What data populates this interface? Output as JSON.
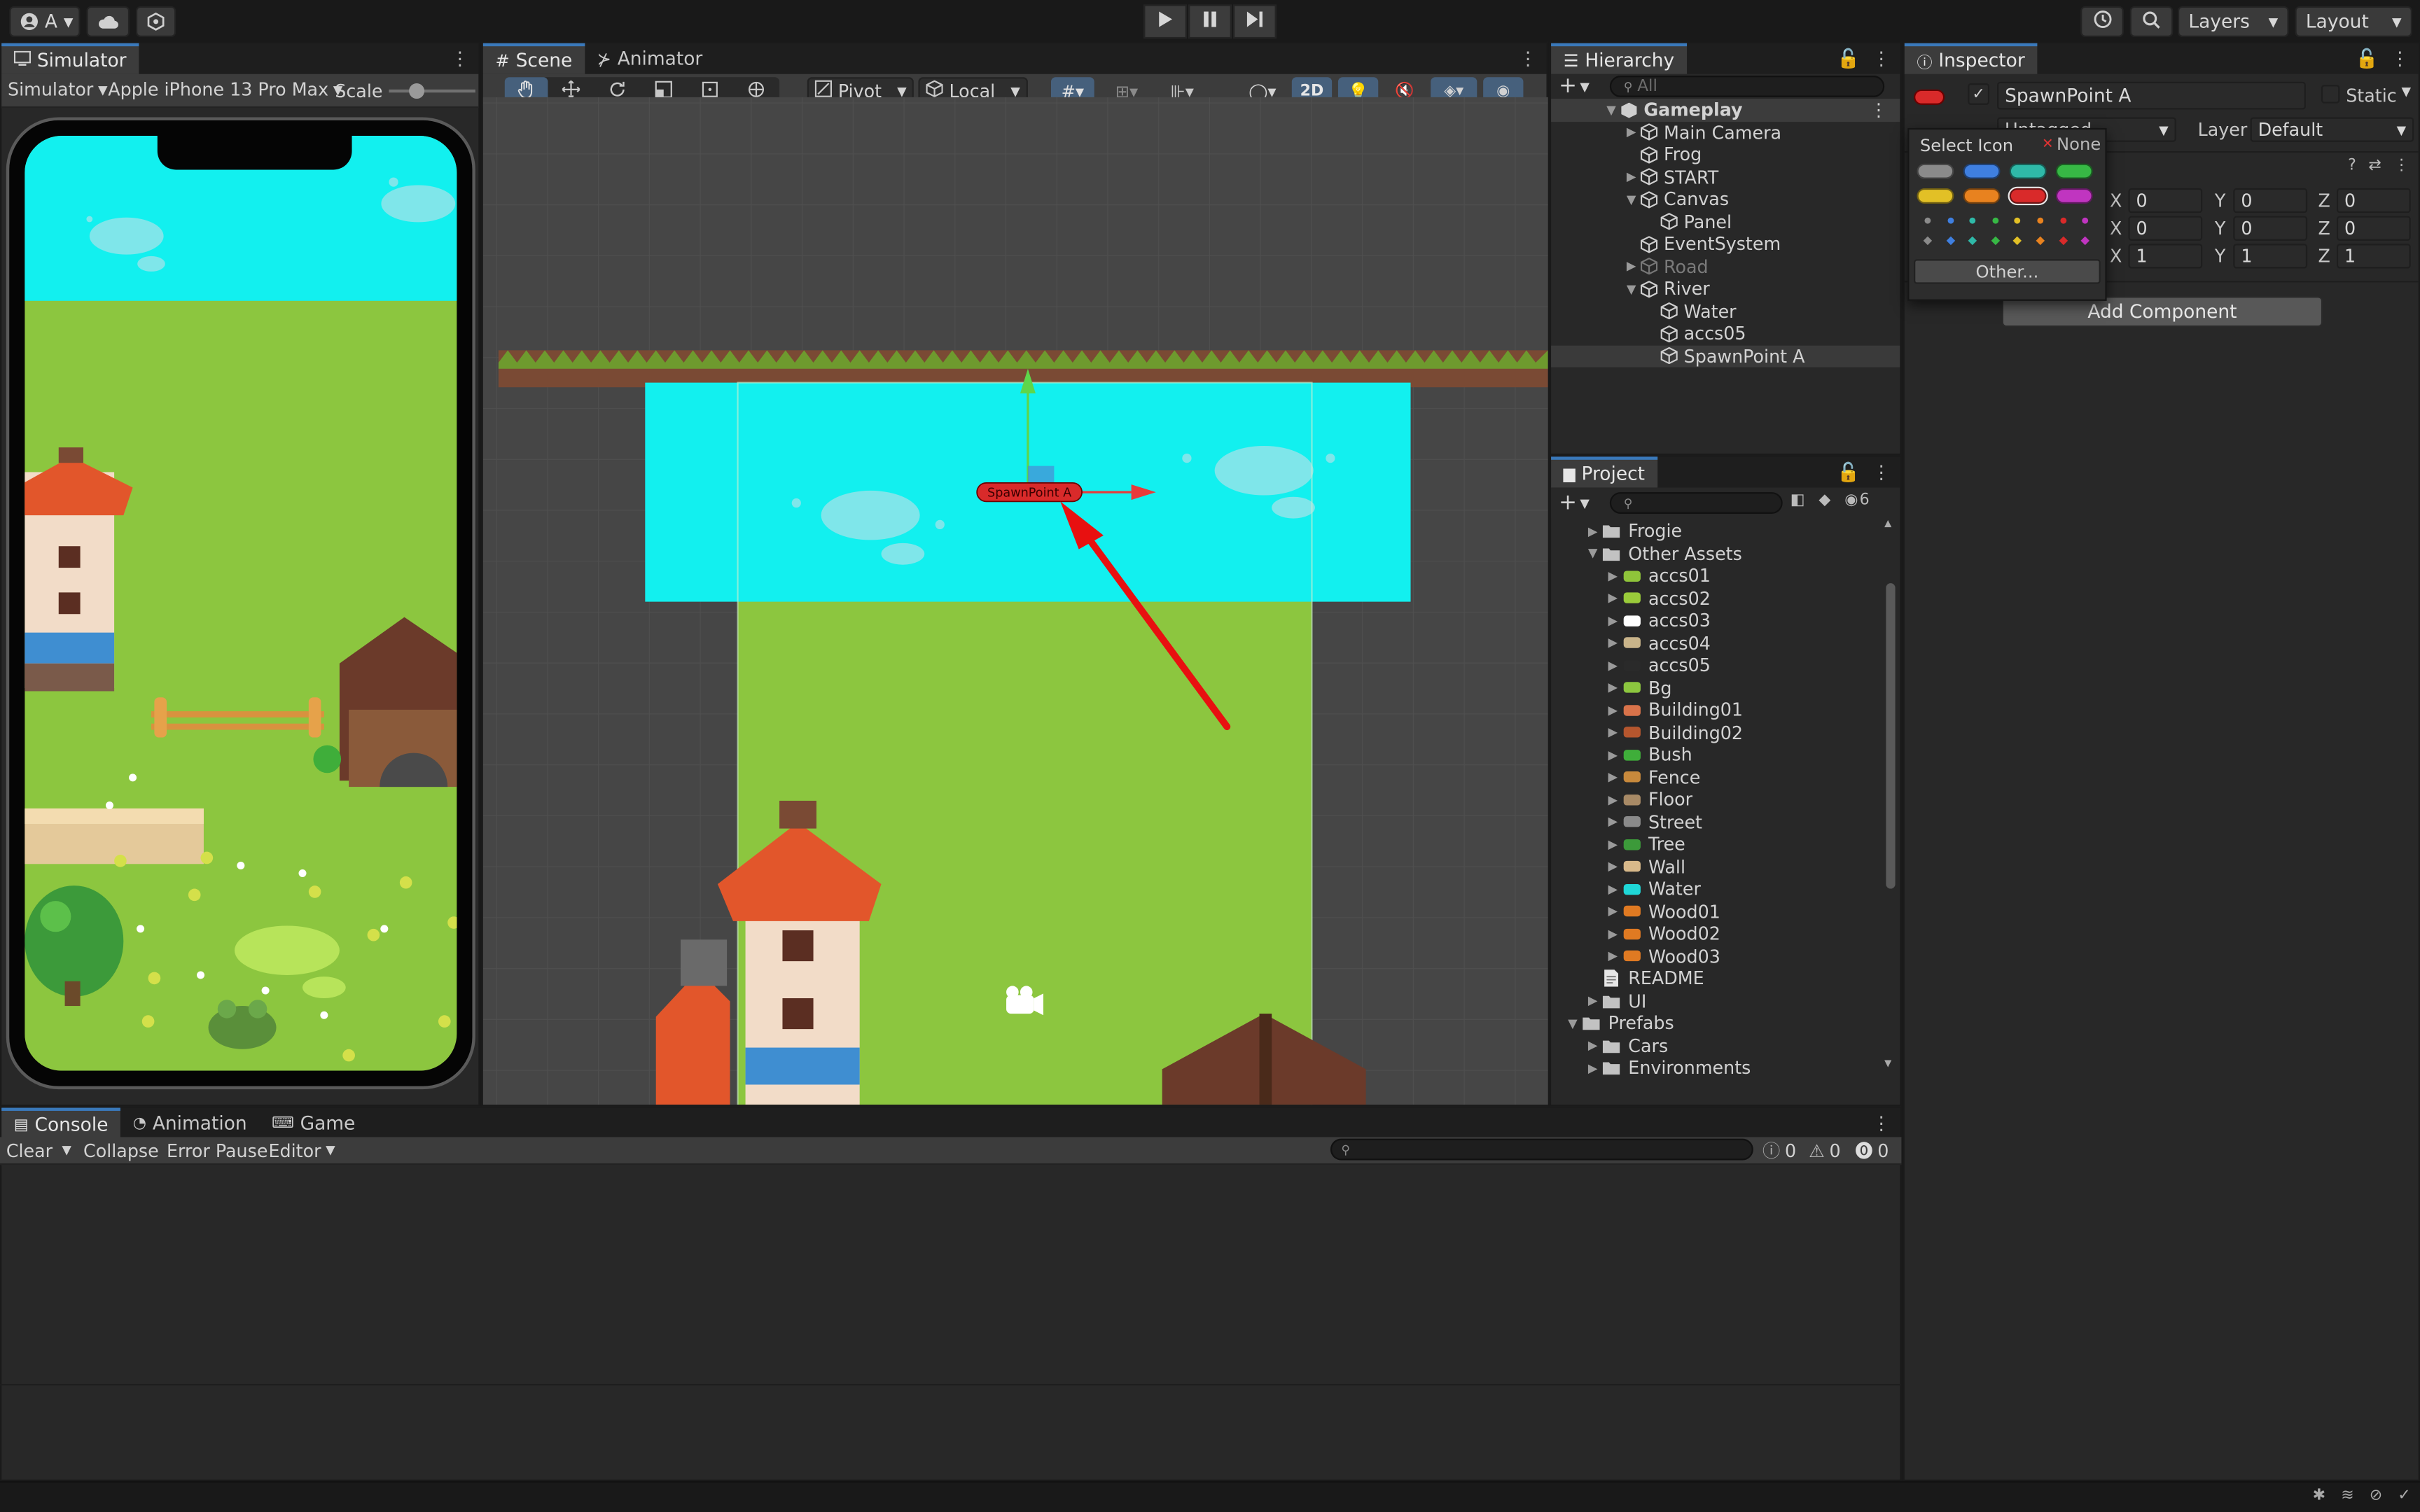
{
  "toolbar": {
    "account_label": "A",
    "layers_label": "Layers",
    "layout_label": "Layout"
  },
  "simulator": {
    "tab_label": "Simulator",
    "mode_label": "Simulator",
    "device_label": "Apple iPhone 13 Pro Max",
    "scale_label": "Scale"
  },
  "scene": {
    "tab_label": "Scene",
    "animator_tab_label": "Animator",
    "pivot_label": "Pivot",
    "local_label": "Local",
    "mode_2d_label": "2D",
    "gizmo_label": "SpawnPoint A"
  },
  "hierarchy": {
    "tab_label": "Hierarchy",
    "search_placeholder": "All",
    "items": [
      {
        "label": "Gameplay",
        "kind": "scene"
      },
      {
        "label": "Main Camera",
        "kind": "object"
      },
      {
        "label": "Frog",
        "kind": "object"
      },
      {
        "label": "START",
        "kind": "object"
      },
      {
        "label": "Canvas",
        "kind": "object"
      },
      {
        "label": "Panel",
        "kind": "object"
      },
      {
        "label": "EventSystem",
        "kind": "object"
      },
      {
        "label": "Road",
        "kind": "disabled"
      },
      {
        "label": "River",
        "kind": "object"
      },
      {
        "label": "Water",
        "kind": "object"
      },
      {
        "label": "accs05",
        "kind": "object"
      },
      {
        "label": "SpawnPoint A",
        "kind": "selected"
      }
    ]
  },
  "project": {
    "tab_label": "Project",
    "hidden_count": "6",
    "items": [
      {
        "label": "Frogie",
        "icon": "folder-icon"
      },
      {
        "label": "Other Assets",
        "icon": "folder-open-icon"
      },
      {
        "label": "accs01",
        "icon": "sprite-icon",
        "color": "#8fc43a"
      },
      {
        "label": "accs02",
        "icon": "sprite-icon",
        "color": "#9acb3a"
      },
      {
        "label": "accs03",
        "icon": "sprite-icon",
        "color": "#ffffff"
      },
      {
        "label": "accs04",
        "icon": "sprite-icon",
        "color": "#c9b48a"
      },
      {
        "label": "accs05",
        "icon": "sprite-icon",
        "color": "#2a2a2a"
      },
      {
        "label": "Bg",
        "icon": "sprite-icon",
        "color": "#8cc63f"
      },
      {
        "label": "Building01",
        "icon": "sprite-icon",
        "color": "#d9734a"
      },
      {
        "label": "Building02",
        "icon": "sprite-icon",
        "color": "#b5562e"
      },
      {
        "label": "Bush",
        "icon": "sprite-icon",
        "color": "#3fae3a"
      },
      {
        "label": "Fence",
        "icon": "sprite-icon",
        "color": "#c8893c"
      },
      {
        "label": "Floor",
        "icon": "sprite-icon",
        "color": "#a88a66"
      },
      {
        "label": "Street",
        "icon": "sprite-icon",
        "color": "#8a8a8a"
      },
      {
        "label": "Tree",
        "icon": "sprite-icon",
        "color": "#3c9a3a"
      },
      {
        "label": "Wall",
        "icon": "sprite-icon",
        "color": "#d8b98a"
      },
      {
        "label": "Water",
        "icon": "sprite-icon",
        "color": "#1fd7d7"
      },
      {
        "label": "Wood01",
        "icon": "sprite-icon",
        "color": "#e07a22"
      },
      {
        "label": "Wood02",
        "icon": "sprite-icon",
        "color": "#e07a22"
      },
      {
        "label": "Wood03",
        "icon": "sprite-icon",
        "color": "#e07a22"
      },
      {
        "label": "README",
        "icon": "document-icon"
      },
      {
        "label": "UI",
        "icon": "folder-icon"
      },
      {
        "label": "Prefabs",
        "icon": "folder-open-icon"
      },
      {
        "label": "Cars",
        "icon": "folder-icon"
      },
      {
        "label": "Environments",
        "icon": "folder-icon"
      }
    ]
  },
  "inspector": {
    "tab_label": "Inspector",
    "object_name": "SpawnPoint A",
    "static_label": "Static",
    "tag_value": "Untagged",
    "layer_label": "Layer",
    "layer_value": "Default",
    "position": {
      "x": "0",
      "y": "0",
      "z": "0"
    },
    "rotation": {
      "x": "0",
      "y": "0",
      "z": "0"
    },
    "scale": {
      "x": "1",
      "y": "1",
      "z": "1"
    },
    "add_component_label": "Add Component"
  },
  "icon_popup": {
    "title": "Select Icon",
    "none_label": "None",
    "other_label": "Other...",
    "pill_colors": [
      "#8a8a8a",
      "#3f7fe0",
      "#2fb9a8",
      "#37b845",
      "#e2c026",
      "#e8821f",
      "#d92a2a",
      "#c035c0"
    ]
  },
  "console": {
    "tab_label": "Console",
    "animation_tab_label": "Animation",
    "game_tab_label": "Game",
    "clear_label": "Clear",
    "collapse_label": "Collapse",
    "error_pause_label": "Error Pause",
    "editor_label": "Editor",
    "log_count": "0",
    "warning_count": "0",
    "error_count": "0"
  }
}
